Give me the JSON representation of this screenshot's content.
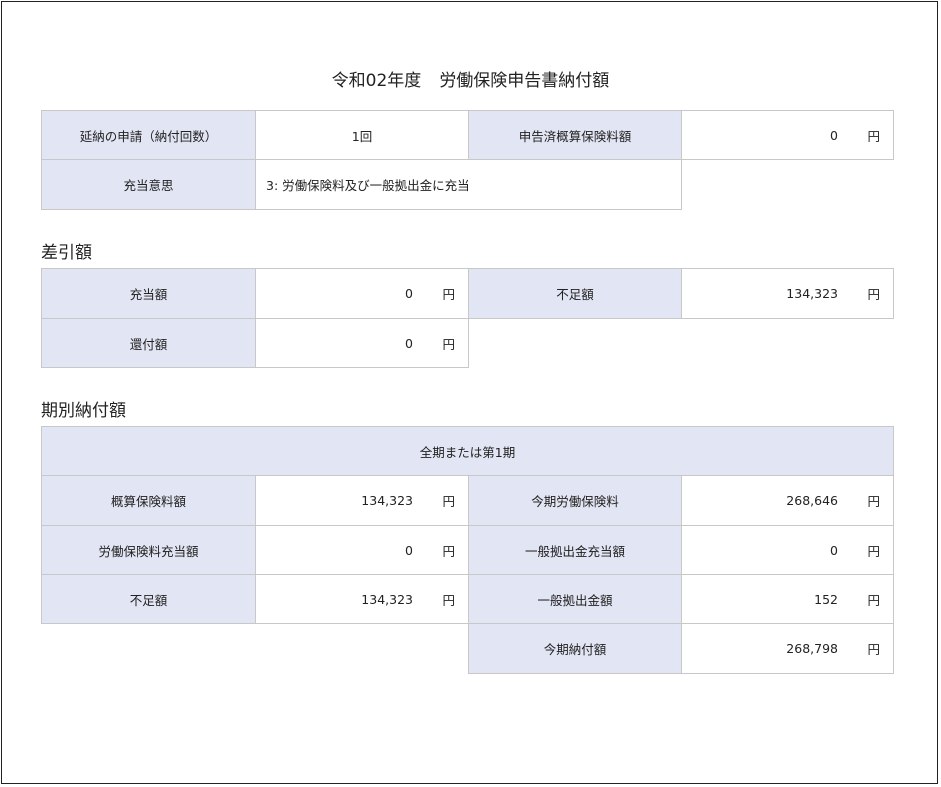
{
  "title": {
    "era": "令和02年度",
    "name": "労働保険申告書納付額"
  },
  "yen": "円",
  "top": {
    "deferral_label": "延納の申請（納付回数）",
    "deferral_value": "1回",
    "declared_label": "申告済概算保険料額",
    "declared_value": "0",
    "intent_label": "充当意思",
    "intent_value": "3: 労働保険料及び一般拠出金に充当"
  },
  "diff": {
    "heading": "差引額",
    "allot_label": "充当額",
    "allot_value": "0",
    "short_label": "不足額",
    "short_value": "134,323",
    "refund_label": "還付額",
    "refund_value": "0"
  },
  "period": {
    "heading": "期別納付額",
    "header": "全期または第1期",
    "est_label": "概算保険料額",
    "est_value": "134,323",
    "curlabor_label": "今期労働保険料",
    "curlabor_value": "268,646",
    "laborallot_label": "労働保険料充当額",
    "laborallot_value": "0",
    "genallot_label": "一般拠出金充当額",
    "genallot_value": "0",
    "short_label": "不足額",
    "short_value": "134,323",
    "gen_label": "一般拠出金額",
    "gen_value": "152",
    "curpay_label": "今期納付額",
    "curpay_value": "268,798"
  }
}
